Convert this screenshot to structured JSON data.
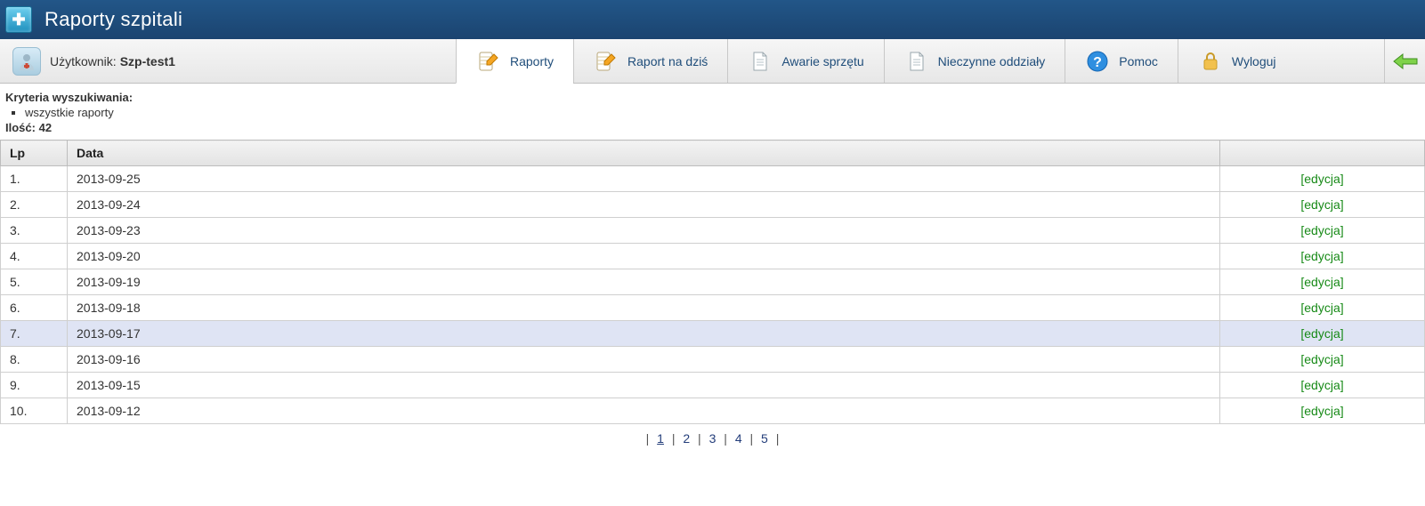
{
  "titlebar": {
    "app_icon_glyph": "✚",
    "title": "Raporty szpitali"
  },
  "user": {
    "label": "Użytkownik:",
    "name": "Szp-test1"
  },
  "nav": {
    "tabs": [
      {
        "id": "reports",
        "label": "Raporty",
        "icon": "notebook-pencil-icon",
        "active": true
      },
      {
        "id": "report-today",
        "label": "Raport na dziś",
        "icon": "notebook-pencil-icon",
        "active": false
      },
      {
        "id": "equipment",
        "label": "Awarie sprzętu",
        "icon": "document-icon",
        "active": false
      },
      {
        "id": "closed-wards",
        "label": "Nieczynne oddziały",
        "icon": "document-icon",
        "active": false
      },
      {
        "id": "help",
        "label": "Pomoc",
        "icon": "help-icon",
        "active": false
      },
      {
        "id": "logout",
        "label": "Wyloguj",
        "icon": "lock-icon",
        "active": false
      }
    ]
  },
  "criteria": {
    "heading": "Kryteria wyszukiwania:",
    "items": [
      "wszystkie raporty"
    ],
    "count_label": "Ilość:",
    "count_value": "42"
  },
  "table": {
    "columns": [
      "Lp",
      "Data",
      ""
    ],
    "action_label": "[edycja]",
    "rows": [
      {
        "lp": "1.",
        "date": "2013-09-25",
        "hover": false
      },
      {
        "lp": "2.",
        "date": "2013-09-24",
        "hover": false
      },
      {
        "lp": "3.",
        "date": "2013-09-23",
        "hover": false
      },
      {
        "lp": "4.",
        "date": "2013-09-20",
        "hover": false
      },
      {
        "lp": "5.",
        "date": "2013-09-19",
        "hover": false
      },
      {
        "lp": "6.",
        "date": "2013-09-18",
        "hover": false
      },
      {
        "lp": "7.",
        "date": "2013-09-17",
        "hover": true
      },
      {
        "lp": "8.",
        "date": "2013-09-16",
        "hover": false
      },
      {
        "lp": "9.",
        "date": "2013-09-15",
        "hover": false
      },
      {
        "lp": "10.",
        "date": "2013-09-12",
        "hover": false
      }
    ]
  },
  "pager": {
    "sep": "|",
    "pages": [
      "1",
      "2",
      "3",
      "4",
      "5"
    ],
    "current": "1"
  }
}
